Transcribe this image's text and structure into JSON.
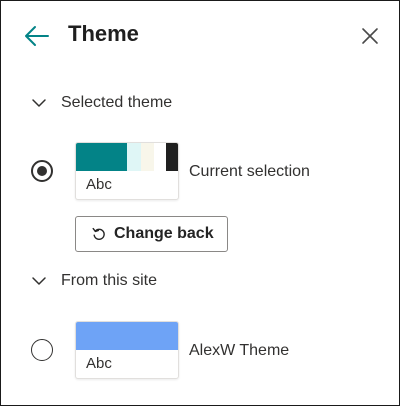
{
  "panel": {
    "title": "Theme",
    "back_icon": "arrow-left-icon",
    "close_icon": "close-icon"
  },
  "sections": {
    "selected": {
      "label": "Selected theme",
      "expanded": true,
      "theme": {
        "preview_text": "Abc",
        "name": "Current selection",
        "checked": true,
        "swatches": [
          "#038387",
          "#dff6f6",
          "#f8f6ea",
          "#ffffff",
          "#1f1f1f"
        ]
      },
      "change_back": {
        "label": "Change back",
        "icon": "undo-icon"
      }
    },
    "from_site": {
      "label": "From this site",
      "expanded": true,
      "themes": [
        {
          "preview_text": "Abc",
          "name": "AlexW Theme",
          "checked": false,
          "swatches": [
            "#6ea3f6"
          ]
        }
      ]
    }
  },
  "colors": {
    "accent": "#038387",
    "text": "#242424",
    "border": "#8a8886"
  }
}
